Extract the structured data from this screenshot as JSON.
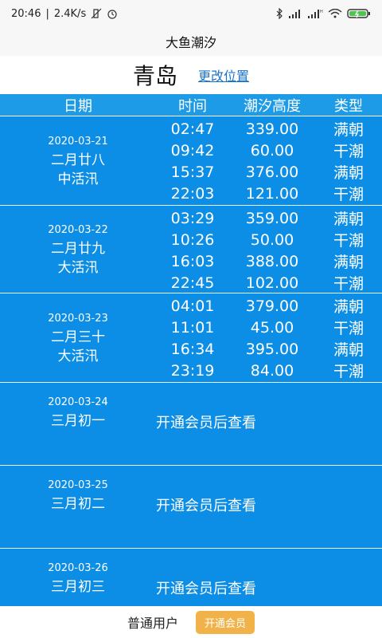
{
  "status": {
    "time": "20:46",
    "net": "2.4K/s",
    "icons": [
      "mute-icon",
      "alarm-icon",
      "bluetooth-icon",
      "signal-icon",
      "hd-signal-icon",
      "wifi-icon",
      "battery-charging-icon"
    ]
  },
  "app": {
    "title": "大鱼潮汐"
  },
  "location": {
    "city": "青岛",
    "change_label": "更改位置"
  },
  "table": {
    "headers": {
      "date": "日期",
      "time": "时间",
      "height": "潮汐高度",
      "type": "类型"
    },
    "days": [
      {
        "date": "2020-03-21",
        "lunar": "二月廿八",
        "tide": "中活汛",
        "entries": [
          {
            "time": "02:47",
            "height": "339.00",
            "type": "满朝"
          },
          {
            "time": "09:42",
            "height": "60.00",
            "type": "干潮"
          },
          {
            "time": "15:37",
            "height": "376.00",
            "type": "满朝"
          },
          {
            "time": "22:03",
            "height": "121.00",
            "type": "干潮"
          }
        ]
      },
      {
        "date": "2020-03-22",
        "lunar": "二月廿九",
        "tide": "大活汛",
        "entries": [
          {
            "time": "03:29",
            "height": "359.00",
            "type": "满朝"
          },
          {
            "time": "10:26",
            "height": "50.00",
            "type": "干潮"
          },
          {
            "time": "16:03",
            "height": "388.00",
            "type": "满朝"
          },
          {
            "time": "22:45",
            "height": "102.00",
            "type": "干潮"
          }
        ]
      },
      {
        "date": "2020-03-23",
        "lunar": "二月三十",
        "tide": "大活汛",
        "entries": [
          {
            "time": "04:01",
            "height": "379.00",
            "type": "满朝"
          },
          {
            "time": "11:01",
            "height": "45.00",
            "type": "干潮"
          },
          {
            "time": "16:34",
            "height": "395.00",
            "type": "满朝"
          },
          {
            "time": "23:19",
            "height": "84.00",
            "type": "干潮"
          }
        ]
      }
    ],
    "locked_days": [
      {
        "date": "2020-03-24",
        "lunar": "三月初一",
        "message": "开通会员后查看"
      },
      {
        "date": "2020-03-25",
        "lunar": "三月初二",
        "message": "开通会员后查看"
      },
      {
        "date": "2020-03-26",
        "lunar": "三月初三",
        "message": "开通会员后查看"
      }
    ]
  },
  "footer": {
    "user_type": "普通用户",
    "vip_button": "开通会员"
  }
}
